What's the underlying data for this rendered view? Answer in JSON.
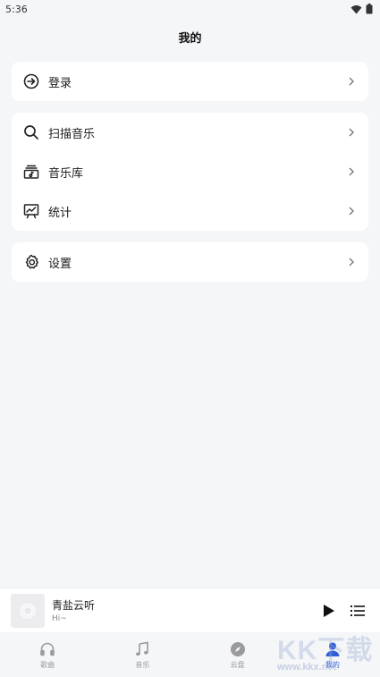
{
  "status_bar": {
    "time": "5:36"
  },
  "header": {
    "title": "我的"
  },
  "card_login": {
    "items": [
      {
        "label": "登录",
        "icon": "login-icon"
      }
    ]
  },
  "card_main": {
    "items": [
      {
        "label": "扫描音乐",
        "icon": "search-icon"
      },
      {
        "label": "音乐库",
        "icon": "library-icon"
      },
      {
        "label": "统计",
        "icon": "chart-icon"
      }
    ]
  },
  "card_settings": {
    "items": [
      {
        "label": "设置",
        "icon": "gear-icon"
      }
    ]
  },
  "player": {
    "title": "青盐云听",
    "subtitle": "Hi~"
  },
  "tabs": [
    {
      "label": "歌曲",
      "icon": "headphones-icon",
      "active": false
    },
    {
      "label": "音乐",
      "icon": "music-note-icon",
      "active": false
    },
    {
      "label": "云盘",
      "icon": "compass-icon",
      "active": false
    },
    {
      "label": "我的",
      "icon": "user-icon",
      "active": true
    }
  ],
  "colors": {
    "accent": "#2f5fd6",
    "background": "#f5f6f8",
    "card": "#ffffff"
  },
  "watermark": {
    "text": "KK下载",
    "url": "www.kkx.net"
  }
}
